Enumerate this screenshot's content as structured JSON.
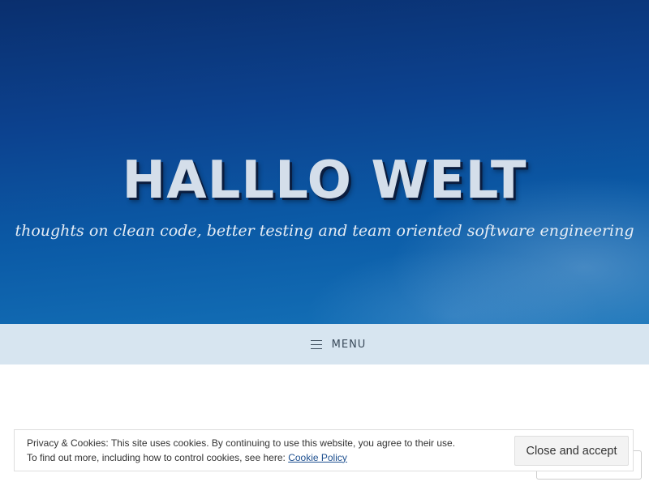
{
  "header": {
    "site_title": "HALLLO WELT",
    "tagline": "thoughts on clean code, better testing and team oriented software engineering"
  },
  "navigation": {
    "menu_label": "MENU",
    "menu_icon": "hamburger-icon"
  },
  "cookie_banner": {
    "line1": "Privacy & Cookies: This site uses cookies. By continuing to use this website, you agree to their use.",
    "line2_prefix": "To find out more, including how to control cookies, see here: ",
    "policy_link": "Cookie Policy",
    "accept_button": "Close and accept"
  },
  "colors": {
    "hero_top": "#0a2f6e",
    "hero_bottom": "#1472b8",
    "menu_bar": "#d7e5f0",
    "link": "#1d4f8f"
  }
}
